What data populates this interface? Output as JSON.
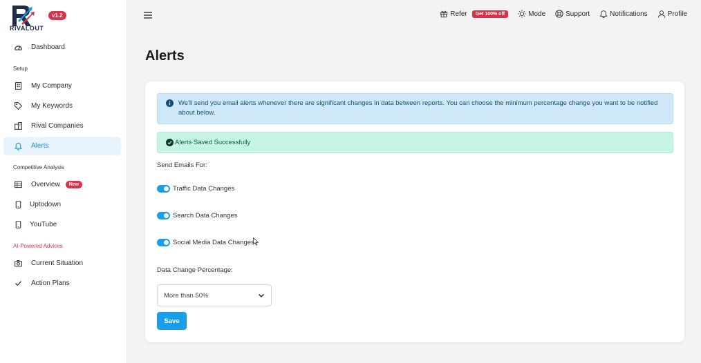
{
  "brand": {
    "name": "RIVALOUT",
    "version": "v1.2"
  },
  "sidebar": {
    "dashboard": "Dashboard",
    "setup_label": "Setup",
    "setup_items": [
      {
        "label": "My Company",
        "icon": "building-icon"
      },
      {
        "label": "My Keywords",
        "icon": "tag-icon"
      },
      {
        "label": "Rival Companies",
        "icon": "city-icon"
      },
      {
        "label": "Alerts",
        "icon": "bell-icon",
        "active": true
      }
    ],
    "competitive_label": "Competitive Analysis",
    "competitive_items": [
      {
        "label": "Overview",
        "icon": "table-icon",
        "badge": "New"
      },
      {
        "label": "Uptodown",
        "icon": "mobile-icon"
      },
      {
        "label": "YouTube",
        "icon": "mobile-icon"
      }
    ],
    "ai_label": "AI-Powered Advices",
    "ai_items": [
      {
        "label": "Current Situation",
        "icon": "camera-icon"
      },
      {
        "label": "Action Plans",
        "icon": "check-icon"
      }
    ]
  },
  "topbar": {
    "refer": "Refer",
    "refer_badge": "Get 100% off",
    "mode": "Mode",
    "support": "Support",
    "notifications": "Notifications",
    "profile": "Profile"
  },
  "page": {
    "title": "Alerts",
    "info": "We'll send you email alerts whenever there are significant changes in data between reports. You can choose the minimum percentage change you want to be notified about below.",
    "success": "Alerts Saved Successfully",
    "send_emails_label": "Send Emails For:",
    "toggles": [
      {
        "label": "Traffic Data Changes",
        "on": true
      },
      {
        "label": "Search Data Changes",
        "on": true
      },
      {
        "label": "Social Media Data Changes",
        "on": true
      }
    ],
    "percentage_label": "Data Change Percentage:",
    "percentage_value": "More than 50%",
    "save_label": "Save"
  },
  "colors": {
    "accent": "#1a9ee8",
    "badge": "#d9334a",
    "info_bg": "#cfe8f7",
    "success_bg": "#c6f4e3"
  }
}
